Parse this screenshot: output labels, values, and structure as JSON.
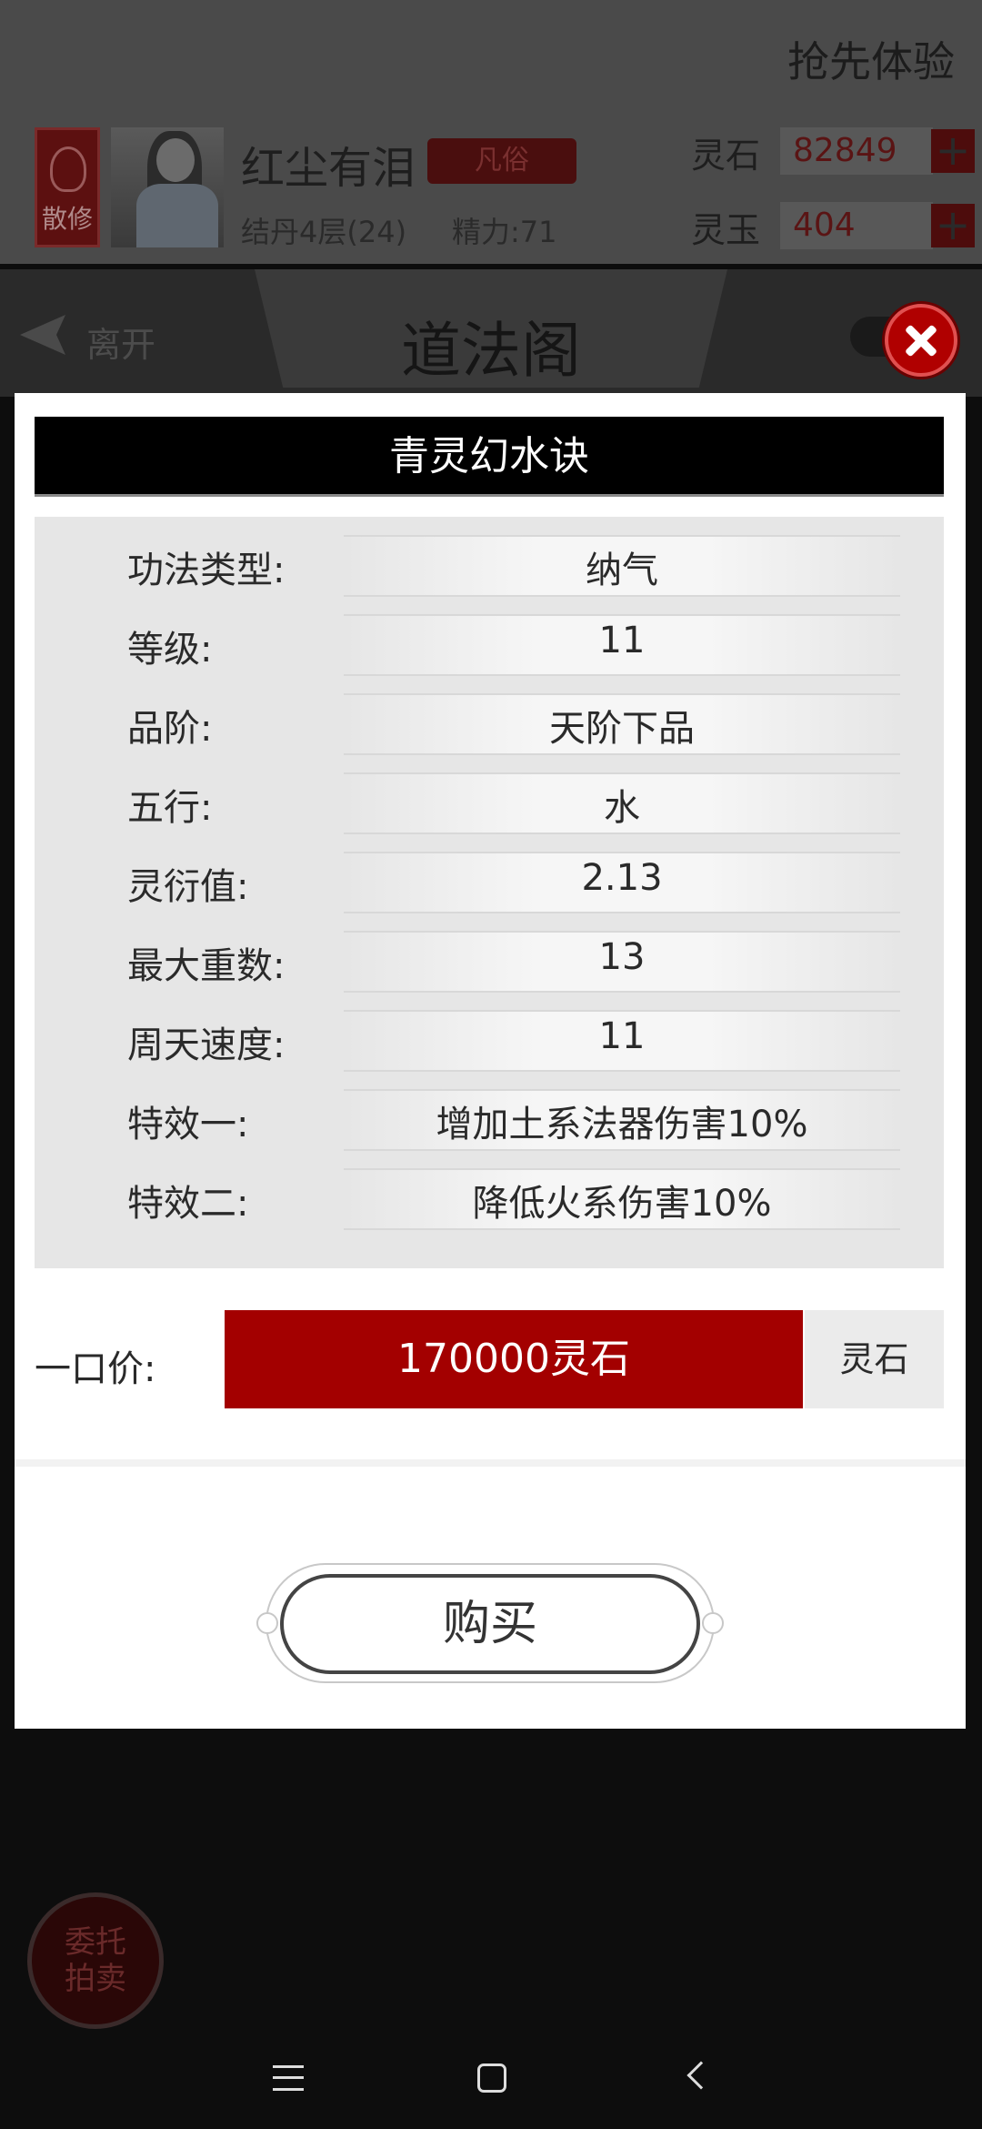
{
  "header": {
    "early_access": "抢先体验",
    "rank_badge": "散修",
    "player_name": "红尘有泪",
    "player_tag": "凡俗",
    "stage": "结丹4层(24)",
    "energy": "精力:71",
    "resources": [
      {
        "label": "灵石",
        "value": "82849",
        "plus": "+"
      },
      {
        "label": "灵玉",
        "value": "404",
        "plus": "+"
      }
    ]
  },
  "nav": {
    "leave_label": "离开",
    "title": "道法阁"
  },
  "modal": {
    "title": "青灵幻水诀",
    "properties": [
      {
        "label": "功法类型:",
        "value": "纳气"
      },
      {
        "label": "等级:",
        "value": "11"
      },
      {
        "label": "品阶:",
        "value": "天阶下品"
      },
      {
        "label": "五行:",
        "value": "水"
      },
      {
        "label": "灵衍值:",
        "value": "2.13"
      },
      {
        "label": "最大重数:",
        "value": "13"
      },
      {
        "label": "周天速度:",
        "value": "11"
      },
      {
        "label": "特效一:",
        "value": "增加土系法器伤害10%"
      },
      {
        "label": "特效二:",
        "value": "降低火系伤害10%"
      }
    ],
    "price_label": "一口价:",
    "price_value": "170000灵石",
    "currency": "灵石",
    "buy_label": "购买"
  },
  "background": {
    "delegate_label_line1": "委托",
    "delegate_label_line2": "拍卖"
  },
  "colors": {
    "accent_red": "#a30000",
    "close_red": "#b00000",
    "title_black": "#000000"
  },
  "icons": {
    "close": "close-x-icon",
    "leave": "back-arrow-icon",
    "system_menu": "menu-lines-icon",
    "system_home": "home-square-icon",
    "system_back": "chevron-left-icon"
  }
}
